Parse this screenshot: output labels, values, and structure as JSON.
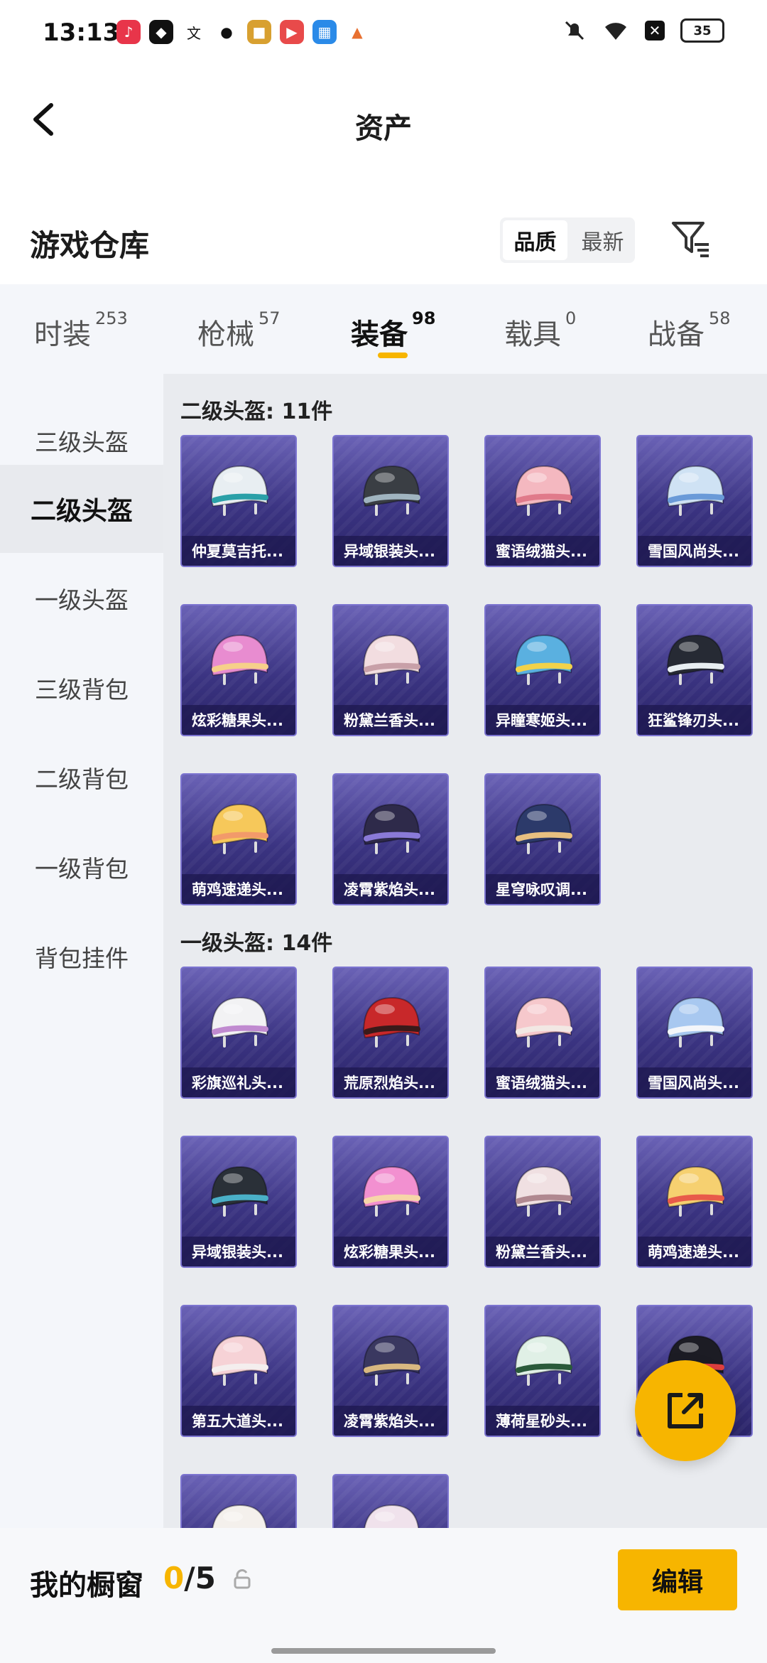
{
  "status": {
    "time": "13:13",
    "battery": "35"
  },
  "header": {
    "title": "资产"
  },
  "warehouse": {
    "title": "游戏仓库",
    "sort_options": [
      "品质",
      "最新"
    ]
  },
  "tabs": [
    {
      "label": "时装",
      "count": "253"
    },
    {
      "label": "枪械",
      "count": "57"
    },
    {
      "label": "装备",
      "count": "98"
    },
    {
      "label": "载具",
      "count": "0"
    },
    {
      "label": "战备",
      "count": "58"
    }
  ],
  "side_menu": [
    "三级头盔",
    "二级头盔",
    "一级头盔",
    "三级背包",
    "二级背包",
    "一级背包",
    "背包挂件"
  ],
  "sections": [
    {
      "title": "二级头盔: 11件",
      "items": [
        {
          "name": "仲夏莫吉托...",
          "color": "#e8eef2",
          "accent": "#2aa0a8"
        },
        {
          "name": "异域银装头...",
          "color": "#3a3e44",
          "accent": "#a0b4c0"
        },
        {
          "name": "蜜语绒猫头...",
          "color": "#f4b8c0",
          "accent": "#e07a8a"
        },
        {
          "name": "雪国风尚头...",
          "color": "#cfe2f4",
          "accent": "#6a9ad8"
        },
        {
          "name": "炫彩糖果头...",
          "color": "#e88cd0",
          "accent": "#f6d08a"
        },
        {
          "name": "粉黛兰香头...",
          "color": "#f2dde0",
          "accent": "#c8a0a8"
        },
        {
          "name": "异瞳寒姬头...",
          "color": "#5ab0e0",
          "accent": "#f2d24a"
        },
        {
          "name": "狂鲨锋刃头...",
          "color": "#262a34",
          "accent": "#e8eef2"
        },
        {
          "name": "萌鸡速递头...",
          "color": "#f6c85a",
          "accent": "#f29a6a"
        },
        {
          "name": "凌霄紫焰头...",
          "color": "#2e2a4a",
          "accent": "#8a7ad8"
        },
        {
          "name": "星穹咏叹调...",
          "color": "#2c3a6a",
          "accent": "#e8c080"
        }
      ]
    },
    {
      "title": "一级头盔: 14件",
      "items": [
        {
          "name": "彩旗巡礼头...",
          "color": "#f2f2f4",
          "accent": "#c08ad0"
        },
        {
          "name": "荒原烈焰头...",
          "color": "#c8282a",
          "accent": "#3a1a1a"
        },
        {
          "name": "蜜语绒猫头...",
          "color": "#f6c8cc",
          "accent": "#f2e8e4"
        },
        {
          "name": "雪国风尚头...",
          "color": "#a8c8f0",
          "accent": "#f4f6fa"
        },
        {
          "name": "异域银装头...",
          "color": "#2a3038",
          "accent": "#4ab0c8"
        },
        {
          "name": "炫彩糖果头...",
          "color": "#f290d0",
          "accent": "#f6d6a8"
        },
        {
          "name": "粉黛兰香头...",
          "color": "#f0e0e2",
          "accent": "#b08890"
        },
        {
          "name": "萌鸡速递头...",
          "color": "#f6d070",
          "accent": "#e85a4a"
        },
        {
          "name": "第五大道头...",
          "color": "#f6d2d6",
          "accent": "#f4eeee"
        },
        {
          "name": "凌霄紫焰头...",
          "color": "#3a3860",
          "accent": "#d8b880"
        },
        {
          "name": "薄荷星砂头...",
          "color": "#e0f0e6",
          "accent": "#2a5a3a"
        },
        {
          "name": "",
          "color": "#1c1c24",
          "accent": "#e04040"
        },
        {
          "name": "",
          "color": "#f4f0ec",
          "accent": "#e8dcd6"
        },
        {
          "name": "",
          "color": "#f0e2ec",
          "accent": "#e8c8dc"
        }
      ]
    }
  ],
  "showcase": {
    "label": "我的橱窗",
    "current": "0",
    "total": "/5",
    "edit_label": "编辑"
  },
  "colors": {
    "accent": "#f7b500"
  }
}
